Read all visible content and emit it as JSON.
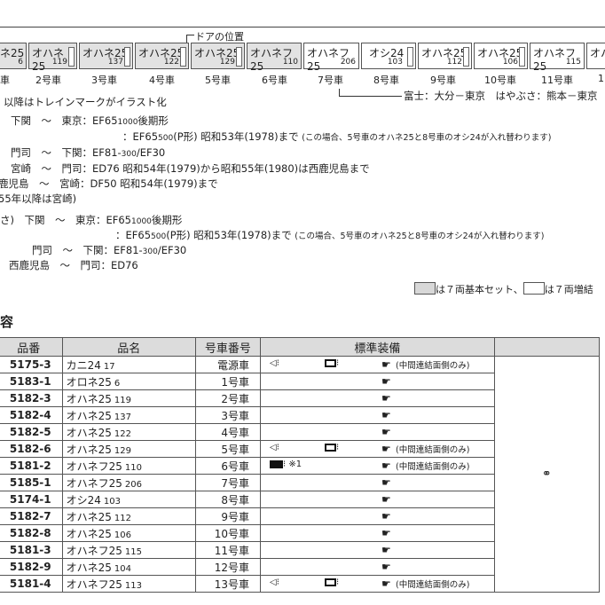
{
  "door_label": "ドアの位置",
  "cars": [
    {
      "name": "ネ25",
      "num": "6",
      "base": true
    },
    {
      "name": "オハネ25",
      "num": "119",
      "base": true
    },
    {
      "name": "オハネ25",
      "num": "137",
      "base": true
    },
    {
      "name": "オハネ25",
      "num": "122",
      "base": true
    },
    {
      "name": "オハネ25",
      "num": "129",
      "base": true
    },
    {
      "name": "オハネフ25",
      "num": "110",
      "base": true
    },
    {
      "name": "オハネフ25",
      "num": "206",
      "base": false
    },
    {
      "name": "オシ24",
      "num": "103",
      "base": false
    },
    {
      "name": "オハネ25",
      "num": "112",
      "base": false
    },
    {
      "name": "オハネ25",
      "num": "106",
      "base": false
    },
    {
      "name": "オハネフ25",
      "num": "115",
      "base": false
    },
    {
      "name": "オハ",
      "num": "",
      "base": false
    }
  ],
  "car_numbers": [
    "車",
    "2号車",
    "3号車",
    "4号車",
    "5号車",
    "6号車",
    "7号車",
    "8号車",
    "9号車",
    "10号車",
    "11号車",
    "1"
  ],
  "fuji_note": "富士：大分－東京　はやぶさ：熊本－東京",
  "lines": [
    "以降はトレインマークがイラスト化",
    "下関　～　東京：EF65",
    "1000",
    "後期形",
    "：EF65",
    "500",
    "(P形) 昭和53年(1978)まで",
    "(この場合、5号車のオハネ25と8号車のオシ24が入れ替わります)",
    "門司　～　下関：EF81-",
    "300",
    "/EF30",
    "宮崎　～　門司：ED76 昭和54年(1979)から昭和55年(1980)は西鹿児島まで",
    "鹿児島　～　宮崎：DF50 昭和54年(1979)まで",
    "55年以降は宮崎)",
    "さ)　下関　～　東京：EF65",
    "門司　～　下関：EF81-",
    "西鹿児島　～　門司：ED76"
  ],
  "legend": {
    "base": "は７両基本セット、",
    "add": "は７両増結"
  },
  "section_title": "容",
  "table": {
    "headers": [
      "品番",
      "品名",
      "号車番号",
      "標準装備",
      ""
    ],
    "rows": [
      {
        "code": "5175-3",
        "name": "カニ24",
        "nb": "17",
        "car": "電源車"
      },
      {
        "code": "5183-1",
        "name": "オロネ25",
        "nb": "6",
        "car": "1号車"
      },
      {
        "code": "5182-3",
        "name": "オハネ25",
        "nb": "119",
        "car": "2号車"
      },
      {
        "code": "5182-4",
        "name": "オハネ25",
        "nb": "137",
        "car": "3号車"
      },
      {
        "code": "5182-5",
        "name": "オハネ25",
        "nb": "122",
        "car": "4号車"
      },
      {
        "code": "5182-6",
        "name": "オハネ25",
        "nb": "129",
        "car": "5号車"
      },
      {
        "code": "5181-2",
        "name": "オハネフ25",
        "nb": "110",
        "car": "6号車"
      },
      {
        "code": "5185-1",
        "name": "オハネフ25",
        "nb": "206",
        "car": "7号車"
      },
      {
        "code": "5174-1",
        "name": "オシ24",
        "nb": "103",
        "car": "8号車"
      },
      {
        "code": "5182-7",
        "name": "オハネ25",
        "nb": "112",
        "car": "9号車"
      },
      {
        "code": "5182-8",
        "name": "オハネ25",
        "nb": "106",
        "car": "10号車"
      },
      {
        "code": "5181-3",
        "name": "オハネフ25",
        "nb": "115",
        "car": "11号車"
      },
      {
        "code": "5182-9",
        "name": "オハネ25",
        "nb": "104",
        "car": "12号車"
      },
      {
        "code": "5181-4",
        "name": "オハネフ25",
        "nb": "113",
        "car": "13号車"
      }
    ],
    "note_mid": "(中間連結面側のみ)",
    "note_ast": "※1"
  }
}
